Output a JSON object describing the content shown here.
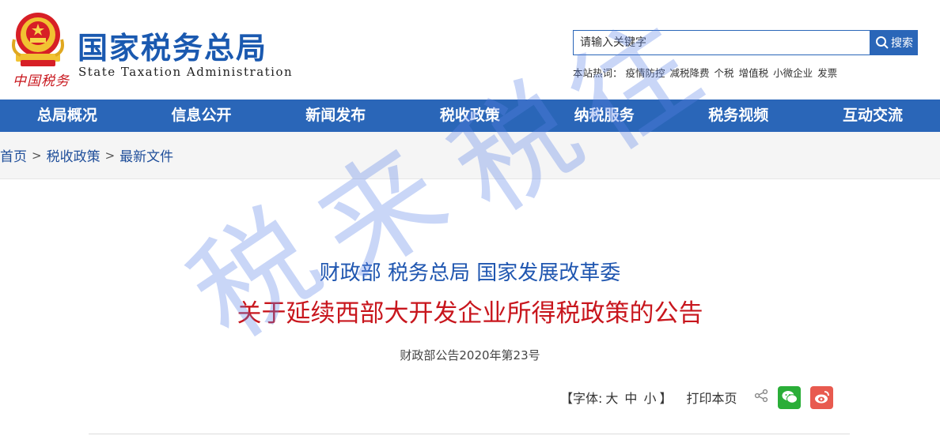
{
  "header": {
    "site_title": "国家税务总局",
    "site_subtitle": "State Taxation Administration",
    "brand_script": "中国税务",
    "search": {
      "placeholder": "请输入关键字",
      "button_label": "搜索"
    },
    "hot_words_label": "本站热词：",
    "hot_words": [
      "疫情防控",
      "减税降费",
      "个税",
      "增值税",
      "小微企业",
      "发票"
    ]
  },
  "nav": {
    "items": [
      "总局概况",
      "信息公开",
      "新闻发布",
      "税收政策",
      "纳税服务",
      "税务视频",
      "互动交流"
    ]
  },
  "breadcrumb": {
    "items": [
      "首页",
      "税收政策",
      "最新文件"
    ],
    "separator": ">"
  },
  "article": {
    "issuers": "财政部 税务总局 国家发展改革委",
    "title": "关于延续西部大开发企业所得税政策的公告",
    "doc_number": "财政部公告2020年第23号",
    "tools": {
      "font_label_open": "【字体:",
      "size_large": "大",
      "size_medium": "中",
      "size_small": "小",
      "font_label_close": "】",
      "print_label": "打印本页"
    }
  },
  "watermark": {
    "chars": [
      "税",
      "来",
      "税",
      "往"
    ]
  },
  "colors": {
    "nav_bg": "#2a66b8",
    "title_red": "#c8161d",
    "issuer_blue": "#1f56b0",
    "wechat_green": "#2aae38",
    "weibo_red": "#e85a4f"
  }
}
